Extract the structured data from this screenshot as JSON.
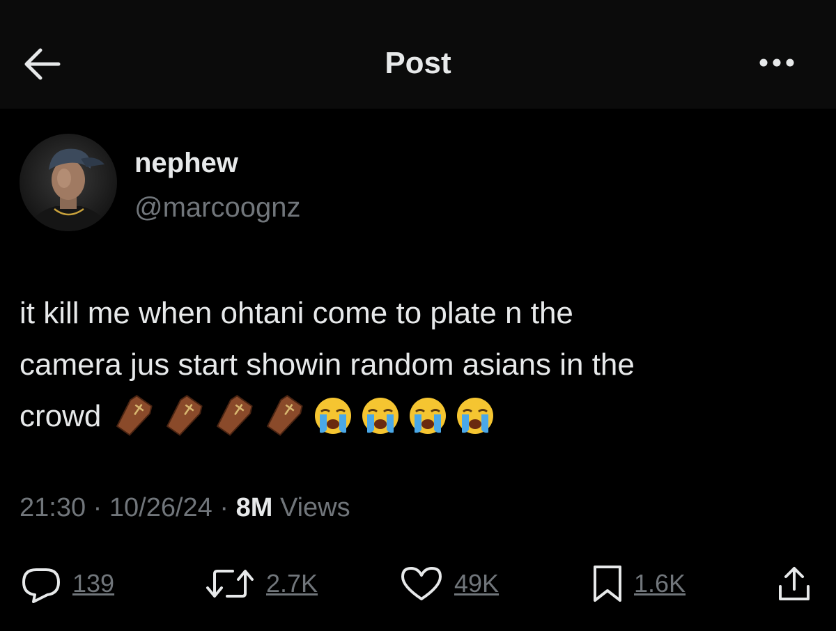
{
  "header": {
    "title": "Post",
    "back_icon": "arrow-left-icon",
    "more_icon": "more-horizontal-icon"
  },
  "author": {
    "display_name": "nephew",
    "handle": "@marcoognz"
  },
  "tweet": {
    "lines": [
      "it kill me when ohtani come to plate n the",
      "camera jus start showin random asians in the",
      "crowd"
    ],
    "emojis": [
      "coffin",
      "coffin",
      "coffin",
      "coffin",
      "loudly-crying-face",
      "loudly-crying-face",
      "loudly-crying-face",
      "loudly-crying-face"
    ]
  },
  "meta": {
    "time": "21:30",
    "date": "10/26/24",
    "views_count": "8M",
    "views_label": "Views",
    "separator": "·"
  },
  "actions": {
    "replies": "139",
    "reposts": "2.7K",
    "likes": "49K",
    "bookmarks": "1.6K"
  },
  "colors": {
    "background": "#000000",
    "header_bg": "#0b0b0b",
    "primary_text": "#e7e9ea",
    "secondary_text": "#71767b"
  }
}
